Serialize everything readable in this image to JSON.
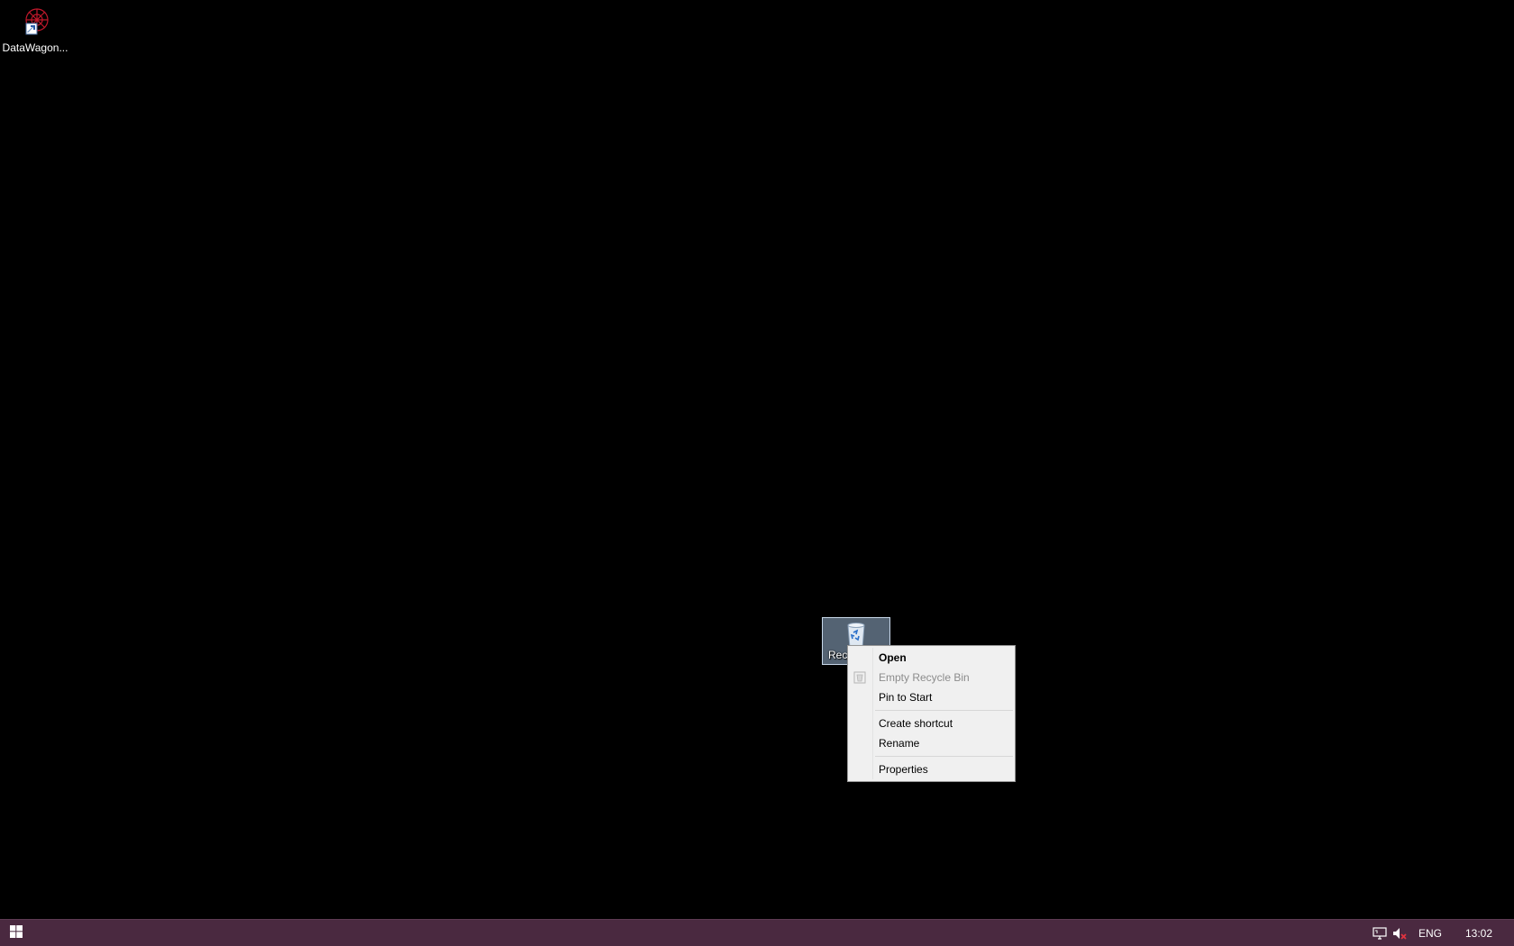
{
  "desktop": {
    "icons": [
      {
        "label": "DataWagon...",
        "icon": "datawagon-shortcut-icon"
      },
      {
        "label": "Rec",
        "icon": "recycle-bin-icon",
        "selected": true
      }
    ]
  },
  "context_menu": {
    "items": [
      {
        "label": "Open",
        "bold": true,
        "disabled": false
      },
      {
        "label": "Empty Recycle Bin",
        "bold": false,
        "disabled": true,
        "icon": "shield-icon"
      },
      {
        "label": "Pin to Start",
        "bold": false,
        "disabled": false
      },
      {
        "label": "Create shortcut",
        "bold": false,
        "disabled": false
      },
      {
        "label": "Rename",
        "bold": false,
        "disabled": false
      },
      {
        "label": "Properties",
        "bold": false,
        "disabled": false
      }
    ]
  },
  "taskbar": {
    "start_icon": "windows-logo-icon",
    "tray": {
      "network_icon": "network-icon",
      "volume_icon": "volume-muted-icon",
      "language": "ENG",
      "clock": "13:02"
    },
    "colors": {
      "background": "#4a2940"
    }
  }
}
